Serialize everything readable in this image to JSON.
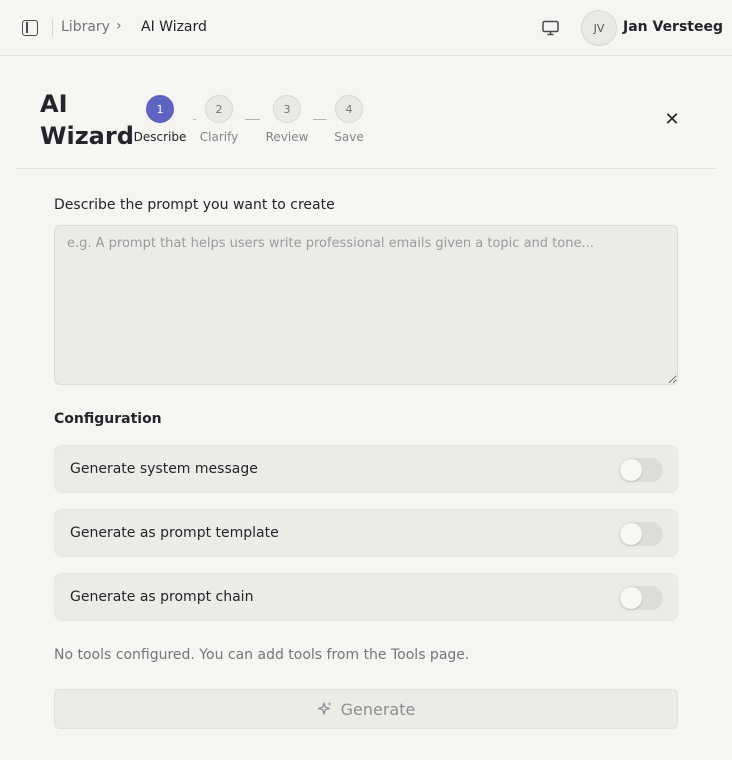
{
  "header": {
    "breadcrumb": [
      "Library",
      "AI Wizard"
    ],
    "chevron": "›",
    "user": {
      "initials": "JV",
      "name": "Jan Versteeg"
    }
  },
  "wizard": {
    "title": "AI Wizard",
    "steps": [
      {
        "number": "1",
        "label": "Describe",
        "active": true
      },
      {
        "number": "2",
        "label": "Clarify",
        "active": false
      },
      {
        "number": "3",
        "label": "Review",
        "active": false
      },
      {
        "number": "4",
        "label": "Save",
        "active": false
      }
    ],
    "close_glyph": "✕"
  },
  "describe": {
    "label": "Describe the prompt you want to create",
    "value": "",
    "placeholder": "e.g. A prompt that helps users write professional emails given a topic and tone..."
  },
  "configuration": {
    "heading": "Configuration",
    "options": [
      {
        "label": "Generate system message",
        "enabled": false
      },
      {
        "label": "Generate as prompt template",
        "enabled": false
      },
      {
        "label": "Generate as prompt chain",
        "enabled": false
      }
    ]
  },
  "tools_note": "No tools configured. You can add tools from the Tools page.",
  "generate": {
    "label": "Generate",
    "disabled": true
  },
  "icons": {
    "sidebar": "sidebar-toggle-icon",
    "monitor": "monitor-icon",
    "close": "close-icon",
    "generate": "sparkle-icon"
  },
  "colors": {
    "accent": "#5f63c2",
    "background": "#f6f5f1",
    "surface": "#edebe6",
    "text": "#25232c",
    "muted": "#76747c"
  }
}
